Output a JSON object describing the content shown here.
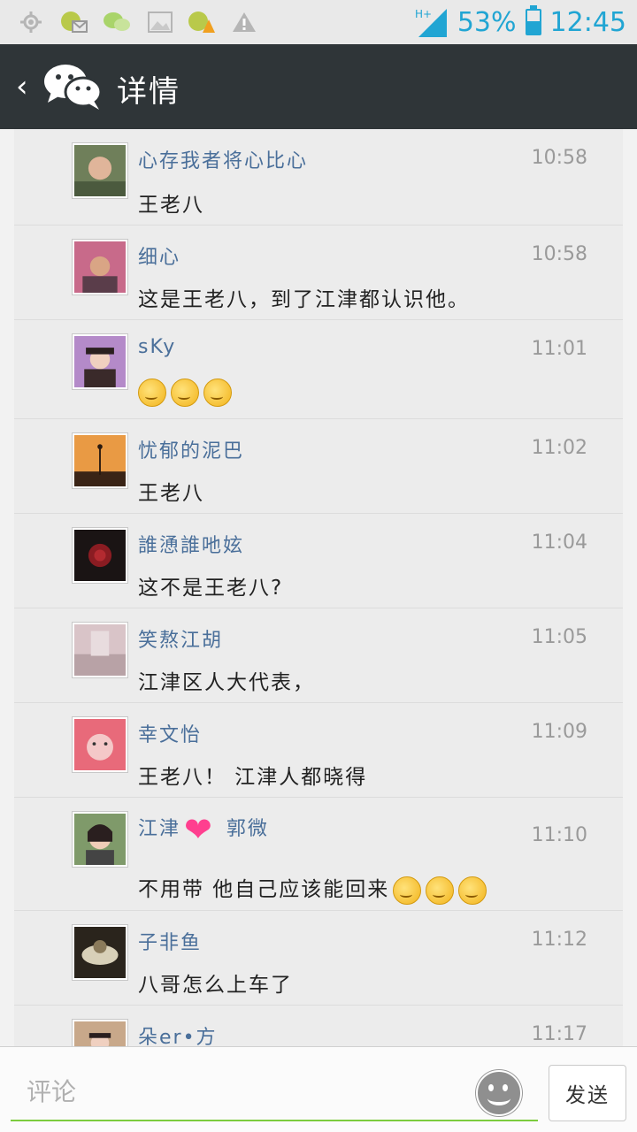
{
  "status_bar": {
    "network": "H+",
    "battery_percent": "53%",
    "battery_level": 0.53,
    "time": "12:45",
    "icons": [
      "gps-icon",
      "message-app-icon",
      "wechat-notification-icon",
      "image-icon",
      "app-warning-icon",
      "warning-icon"
    ],
    "accent": "#21a5d3"
  },
  "title_bar": {
    "back": "‹",
    "title": "详情",
    "background": "#2f3538"
  },
  "comments": [
    {
      "name": "心存我者将心比心",
      "time": "10:58",
      "text": "王老八"
    },
    {
      "name": "细心",
      "time": "10:58",
      "text": "这是王老八，到了江津都认识他。"
    },
    {
      "name": "sKy",
      "time": "11:01",
      "text": "",
      "emoji_count": 3
    },
    {
      "name": "忧郁的泥巴",
      "time": "11:02",
      "text": "王老八"
    },
    {
      "name": "誰慂誰吔妶",
      "time": "11:04",
      "text": "这不是王老八?"
    },
    {
      "name": "笑熬江胡",
      "time": "11:05",
      "text": "江津区人大代表，"
    },
    {
      "name": "幸文怡",
      "time": "11:09",
      "text": "王老八！ 江津人都晓得"
    },
    {
      "name_part1": "江津",
      "name_part2": "郭微",
      "name_heart": "❤",
      "time": "11:10",
      "text": "不用带 他自己应该能回来",
      "emoji_count": 3
    },
    {
      "name": "子非鱼",
      "time": "11:12",
      "text": "八哥怎么上车了"
    },
    {
      "name": "朵er•方",
      "time": "11:17",
      "text": ""
    }
  ],
  "input": {
    "placeholder": "评论",
    "send_label": "发送",
    "accent": "#7ccc3e"
  }
}
